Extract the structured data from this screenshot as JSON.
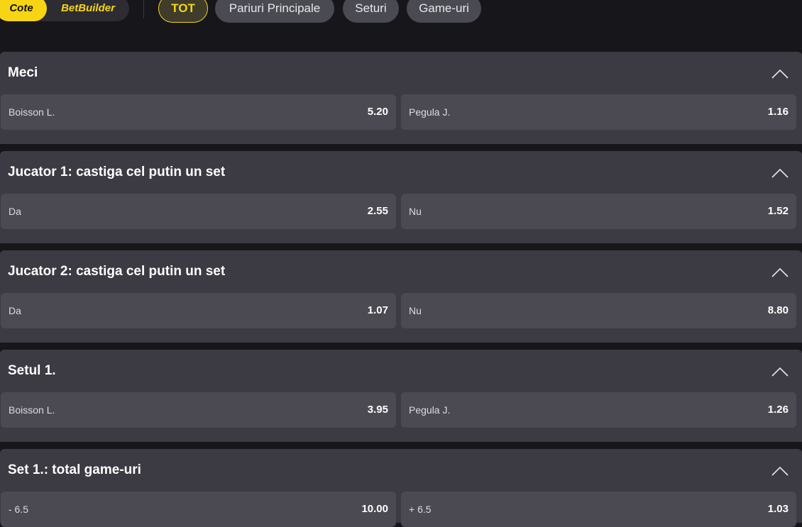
{
  "toggle": {
    "active": "Cote",
    "inactive": "BetBuilder"
  },
  "filters": [
    "TOT",
    "Pariuri Principale",
    "Seturi",
    "Game-uri"
  ],
  "markets": [
    {
      "title": "Meci",
      "left": {
        "label": "Boisson L.",
        "odd": "5.20"
      },
      "right": {
        "label": "Pegula J.",
        "odd": "1.16"
      }
    },
    {
      "title": "Jucator 1: castiga cel putin un set",
      "left": {
        "label": "Da",
        "odd": "2.55"
      },
      "right": {
        "label": "Nu",
        "odd": "1.52"
      }
    },
    {
      "title": "Jucator 2: castiga cel putin un set",
      "left": {
        "label": "Da",
        "odd": "1.07"
      },
      "right": {
        "label": "Nu",
        "odd": "8.80"
      }
    },
    {
      "title": "Setul 1.",
      "left": {
        "label": "Boisson L.",
        "odd": "3.95"
      },
      "right": {
        "label": "Pegula J.",
        "odd": "1.26"
      }
    },
    {
      "title": "Set 1.: total game-uri",
      "left": {
        "label": "- 6.5",
        "odd": "10.00"
      },
      "right": {
        "label": "+ 6.5",
        "odd": "1.03"
      }
    }
  ],
  "colors": {
    "accent": "#f7d514",
    "page_bg": "#17161b",
    "panel_bg": "#3c3b43",
    "odd_bg": "#4b4a52"
  },
  "icons": {
    "collapse": "chevron-up-icon"
  }
}
